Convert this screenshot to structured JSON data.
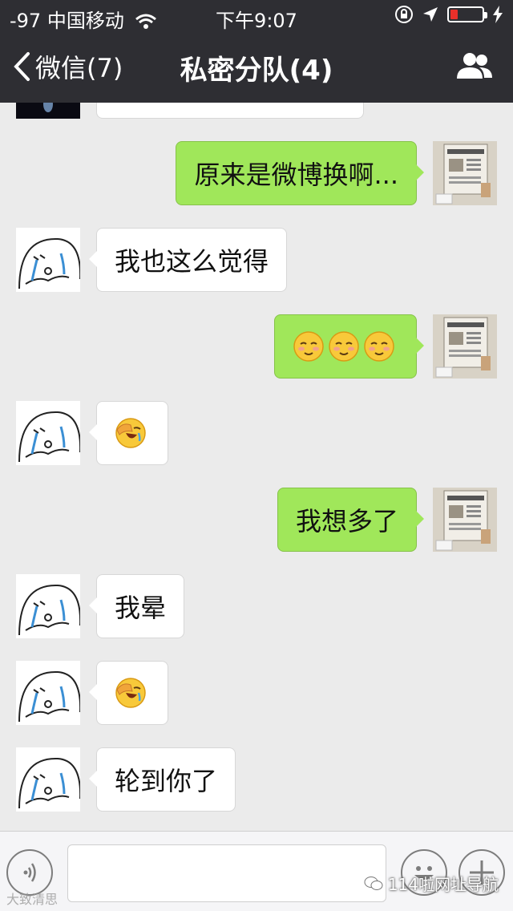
{
  "status_bar": {
    "signal": "-97",
    "carrier": "中国移动",
    "time": "下午9:07"
  },
  "nav": {
    "back_label": "微信(7)",
    "title": "私密分队(4)"
  },
  "messages": [
    {
      "side": "in",
      "type": "text",
      "text": "",
      "avatar": "avatar-dark"
    },
    {
      "side": "out",
      "type": "text",
      "text": "原来是微博换啊...",
      "avatar": "newspaper-avatar"
    },
    {
      "side": "in",
      "type": "text",
      "text": "我也这么觉得",
      "avatar": "bun-avatar"
    },
    {
      "side": "out",
      "type": "emoji",
      "emoji": [
        "relieved-face",
        "relieved-face",
        "relieved-face"
      ],
      "avatar": "newspaper-avatar"
    },
    {
      "side": "in",
      "type": "emoji",
      "emoji": [
        "facepalm-laugh-face"
      ],
      "avatar": "bun-avatar"
    },
    {
      "side": "out",
      "type": "text",
      "text": "我想多了",
      "avatar": "newspaper-avatar"
    },
    {
      "side": "in",
      "type": "text",
      "text": "我晕",
      "avatar": "bun-avatar"
    },
    {
      "side": "in",
      "type": "emoji",
      "emoji": [
        "facepalm-laugh-face"
      ],
      "avatar": "bun-avatar"
    },
    {
      "side": "in",
      "type": "text",
      "text": "轮到你了",
      "avatar": "bun-avatar"
    }
  ],
  "input_bar": {
    "input_value": "",
    "watermark_left": "大致清思",
    "watermark_right": "114啦网址导航"
  },
  "colors": {
    "topbar": "#2e2e33",
    "chat_bg": "#ebebeb",
    "bubble_out": "#a0e75a",
    "bubble_in": "#ffffff",
    "battery_low": "#e8302a"
  }
}
